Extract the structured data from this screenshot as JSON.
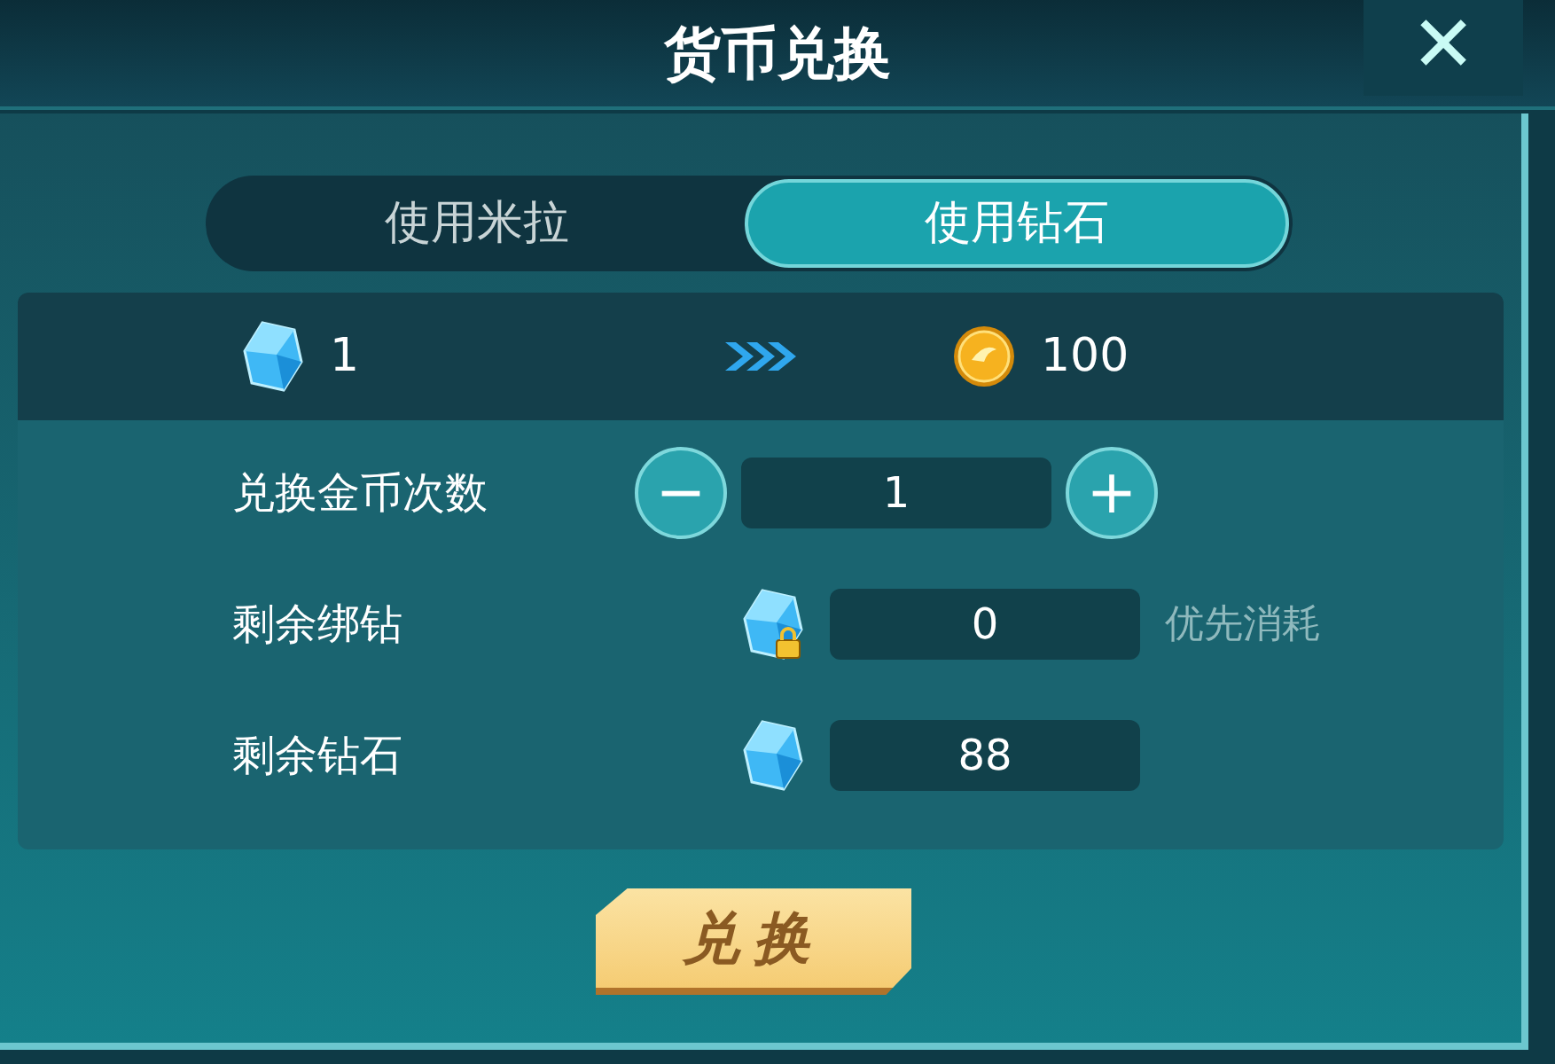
{
  "title": "货币兑换",
  "close": "✕",
  "tabs": [
    {
      "label": "使用米拉",
      "selected": false
    },
    {
      "label": "使用钻石",
      "selected": true
    }
  ],
  "rate": {
    "from": "1",
    "to": "100"
  },
  "rows": [
    {
      "kind": "stepper",
      "label": "兑换金币次数",
      "value": "1",
      "minus": "−",
      "plus": "+"
    },
    {
      "kind": "bound",
      "label": "剩余绑钻",
      "value": "0",
      "note": "优先消耗"
    },
    {
      "kind": "gem",
      "label": "剩余钻石",
      "value": "88"
    }
  ],
  "action": "兑换"
}
